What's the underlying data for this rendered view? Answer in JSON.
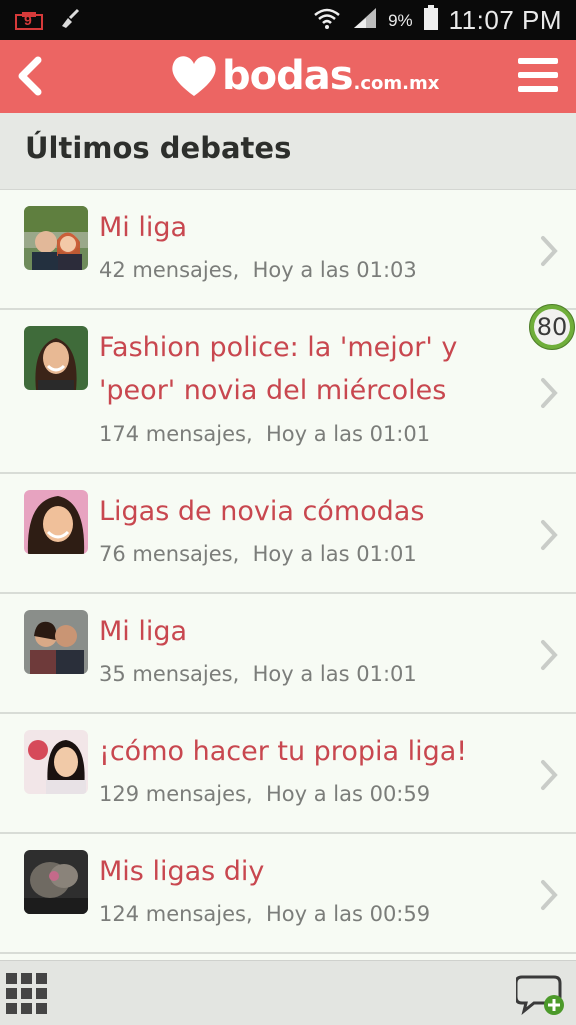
{
  "status_bar": {
    "notification_count": "9",
    "battery_percent": "9%",
    "time": "11:07 PM"
  },
  "app_bar": {
    "logo_word": "bodas",
    "logo_domain": ".com.mx",
    "back_icon": "chevron-left-icon",
    "menu_icon": "hamburger-menu-icon"
  },
  "section": {
    "title": "Últimos debates"
  },
  "debates": [
    {
      "title": "Mi liga",
      "messages": "42 mensajes,",
      "time": "Hoy a las 01:03"
    },
    {
      "title": "Fashion police: la 'mejor' y 'peor' novia del miércoles",
      "messages": "174 mensajes,",
      "time": "Hoy a las 01:01"
    },
    {
      "title": "Ligas de novia cómodas",
      "messages": "76 mensajes,",
      "time": "Hoy a las 01:01"
    },
    {
      "title": "Mi liga",
      "messages": "35 mensajes,",
      "time": "Hoy a las 01:01"
    },
    {
      "title": "¡cómo hacer tu propia liga!",
      "messages": "129 mensajes,",
      "time": "Hoy a las 00:59"
    },
    {
      "title": "Mis ligas diy",
      "messages": "124 mensajes,",
      "time": "Hoy a las 00:59"
    }
  ],
  "floating_badge": {
    "value": "80"
  },
  "bottom_bar": {
    "left_icon": "grid-icon",
    "right_icon": "new-chat-icon"
  },
  "colors": {
    "brand": "#ec6563",
    "title_red": "#c8474f",
    "badge_green": "#6fae3a"
  }
}
